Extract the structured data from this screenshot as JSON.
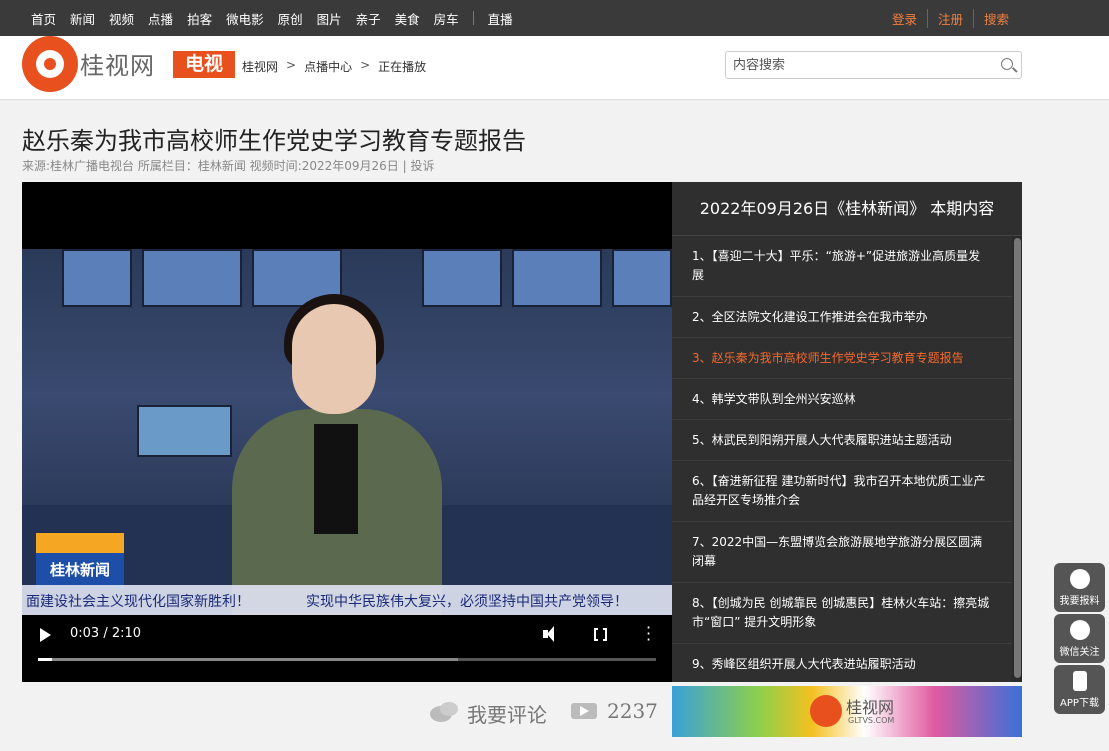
{
  "nav": {
    "items": [
      "首页",
      "新闻",
      "视频",
      "点播",
      "拍客",
      "微电影",
      "原创",
      "图片",
      "亲子",
      "美食",
      "房车",
      "直播"
    ],
    "right": [
      "登录",
      "注册",
      "搜索"
    ]
  },
  "header": {
    "logo_text": "桂视网",
    "channel": "电视",
    "breadcrumb": [
      "桂视网",
      "点播中心",
      "正在播放"
    ],
    "search_placeholder": "内容搜索"
  },
  "article": {
    "title": "赵乐秦为我市高校师生作党史学习教育专题报告",
    "meta": "来源:桂林广播电视台 所属栏目：桂林新闻 视频时间:2022年09月26日 | 投诉"
  },
  "player": {
    "time": "0:03 / 2:10",
    "progress": 0.023,
    "buffered": 0.68,
    "station_logo": "桂林新闻",
    "ticker_left": "面建设社会主义现代化国家新胜利！",
    "ticker_right": "实现中华民族伟大复兴，必须坚持中国共产党领导！"
  },
  "playlist": {
    "title": "2022年09月26日《桂林新闻》 本期内容",
    "items": [
      "1、【喜迎二十大】平乐：“旅游+”促进旅游业高质量发展",
      "2、全区法院文化建设工作推进会在我市举办",
      "3、赵乐秦为我市高校师生作党史学习教育专题报告",
      "4、韩学文带队到全州兴安巡林",
      "5、林武民到阳朔开展人大代表履职进站主题活动",
      "6、【奋进新征程 建功新时代】我市召开本地优质工业产品经开区专场推介会",
      "7、2022中国—东盟博览会旅游展地学旅游分展区圆满闭幕",
      "8、【创城为民 创城靠民 创城惠民】桂林火车站：擦亮城市“窗口” 提升文明形象",
      "9、秀峰区组织开展人大代表进站履职活动"
    ],
    "active_index": 2
  },
  "footer": {
    "comment_label": "我要评论",
    "views": "2237",
    "banner_logo": "桂视网",
    "banner_sub": "GLTVS.COM"
  },
  "side": [
    "我要报料",
    "微信关注",
    "APP下载"
  ]
}
